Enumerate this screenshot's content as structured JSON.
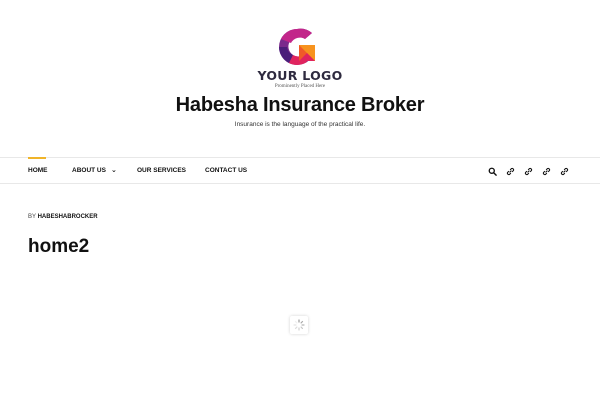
{
  "header": {
    "logo_text": "YOUR LOGO",
    "logo_tagline": "Prominently Placed Here",
    "site_title": "Habesha Insurance Broker",
    "site_tagline": "Insurance is the language of the practical life."
  },
  "nav": {
    "items": [
      {
        "label": "HOME",
        "active": true
      },
      {
        "label": "ABOUT US",
        "has_dropdown": true
      },
      {
        "label": "OUR SERVICES"
      },
      {
        "label": "CONTACT US"
      }
    ],
    "icons": [
      "search-icon",
      "link-icon",
      "link-icon",
      "link-icon",
      "link-icon"
    ],
    "accent_color": "#f0b429"
  },
  "post": {
    "by_label": "BY",
    "author": "HABESHABROCKER",
    "title": "home2"
  },
  "loader": {
    "icon": "loading-spinner-icon"
  }
}
